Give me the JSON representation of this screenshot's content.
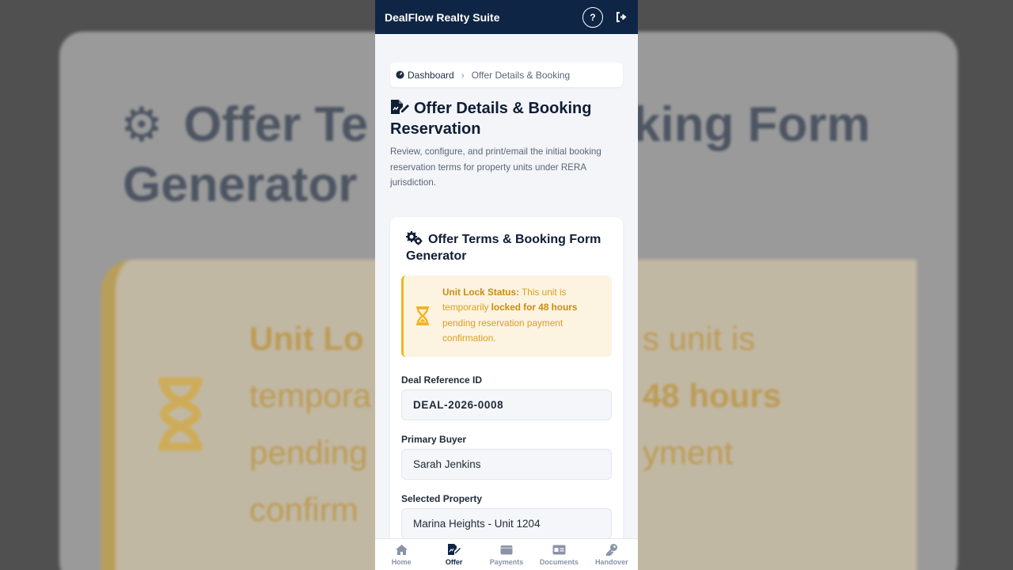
{
  "app": {
    "title": "DealFlow Realty Suite",
    "help_label": "?"
  },
  "breadcrumb": {
    "home": "Dashboard",
    "current": "Offer Details & Booking"
  },
  "page": {
    "title": "Offer Details & Booking Reservation",
    "description": "Review, configure, and print/email the initial booking reservation terms for property units under RERA jurisdiction."
  },
  "card": {
    "title": "Offer Terms & Booking Form Generator",
    "alert": {
      "label": "Unit Lock Status:",
      "text_before": " This unit is temporarily ",
      "emphasis": "locked for 48 hours",
      "text_after": " pending reservation payment confirmation."
    },
    "fields": [
      {
        "label": "Deal Reference ID",
        "value": "DEAL-2026-0008"
      },
      {
        "label": "Primary Buyer",
        "value": "Sarah Jenkins"
      },
      {
        "label": "Selected Property",
        "value": "Marina Heights - Unit 1204"
      }
    ]
  },
  "nav": [
    {
      "label": "Home",
      "icon": "home-icon"
    },
    {
      "label": "Offer",
      "icon": "file-signature-icon",
      "active": true
    },
    {
      "label": "Payments",
      "icon": "wallet-icon"
    },
    {
      "label": "Documents",
      "icon": "id-card-icon"
    },
    {
      "label": "Handover",
      "icon": "key-icon"
    }
  ],
  "backdrop": {
    "title_left": "Offer Te",
    "title_right": "king Form",
    "title_line2": "Generator",
    "alert_left": [
      "Unit Lo",
      "tempora",
      "pending",
      "confirm"
    ],
    "alert_right": [
      "s unit is",
      "48 hours",
      "yment"
    ]
  },
  "colors": {
    "primary": "#0f2545",
    "warning": "#f2b320",
    "background": "#f3f5f8"
  }
}
